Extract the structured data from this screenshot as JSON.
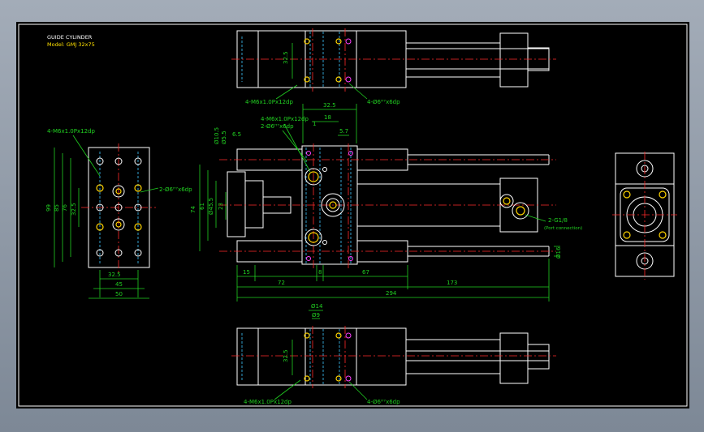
{
  "title": {
    "line1": "GUIDE CYLINDER",
    "line2": "Model: GMJ 32x75"
  },
  "top_view": {
    "dim_pitch": "32.5",
    "label_tap": "4-M6x1.0Px12dp",
    "label_hole": "4-Ø6ᴴ⁷x6dp"
  },
  "side_view": {
    "label_tap": "4-M6x1.0Px12dp",
    "label_hole": "2-Ø6ᴴ⁷x6dp",
    "dim_a": "32.5",
    "dim_b": "18",
    "dim_c": "1",
    "dim_d": "5.7",
    "dim_left1": "Ø10.5",
    "dim_left2": "Ø5.5",
    "dim_left3": "6.5",
    "dim_v1": "74",
    "dim_v2": "61",
    "dim_v3": "Ø45.5",
    "dim_v4": "23",
    "dim_bottom1": "15",
    "dim_bottom2": "72",
    "dim_bottom3": "8",
    "dim_bottom4": "67",
    "dim_bottom5": "173",
    "dim_total": "294",
    "dim_right": "Ø16",
    "port_label": "2-G1/8",
    "port_sub": "(Port connection)"
  },
  "left_view": {
    "label_tap": "4-M6x1.0Px12dp",
    "label_hole": "2-Ø6ᴴ⁷x6dp",
    "dim_v1": "99",
    "dim_v2": "85",
    "dim_v3": "76",
    "dim_v4": "32.5",
    "dim_h1": "32.5",
    "dim_h2": "45",
    "dim_h3": "50"
  },
  "bottom_view": {
    "dim_a": "Ø14",
    "dim_b": "Ø9",
    "dim_pitch": "32.5",
    "label_tap": "4-M6x1.0Px12dp",
    "label_hole": "4-Ø6ᴴ⁷x6dp"
  },
  "colors": {
    "background": "#000000",
    "outline": "#ffffff",
    "center": "#ff2a2a",
    "hidden": "#3fc6ff",
    "dimension": "#21d021",
    "text": "#ffe000"
  }
}
